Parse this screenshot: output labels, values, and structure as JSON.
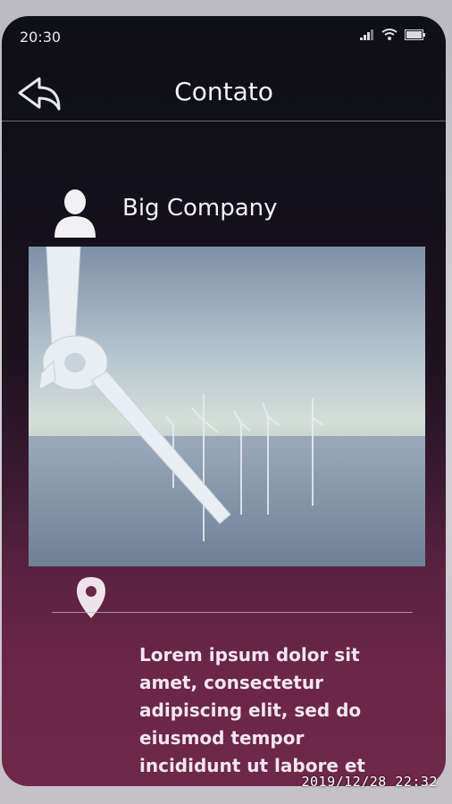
{
  "status_bar": {
    "time": "20:30",
    "icons": [
      "signal-icon",
      "wifi-icon",
      "battery-icon"
    ]
  },
  "header": {
    "title": "Contato",
    "back_icon": "back-arrow-icon"
  },
  "company": {
    "icon": "person-icon",
    "name": "Big Company"
  },
  "hero_image": {
    "subject": "offshore-wind-turbines-photo"
  },
  "location": {
    "icon": "location-pin-icon"
  },
  "description": "Lorem ipsum dolor sit amet, consectetur adipiscing elit, sed do eiusmod tempor incididunt ut labore et",
  "photo_timestamp": "2019/12/28  22:32",
  "colors": {
    "phone_top": "#0f0f17",
    "phone_bottom": "#6e2849",
    "text": "#f3f3f6"
  }
}
